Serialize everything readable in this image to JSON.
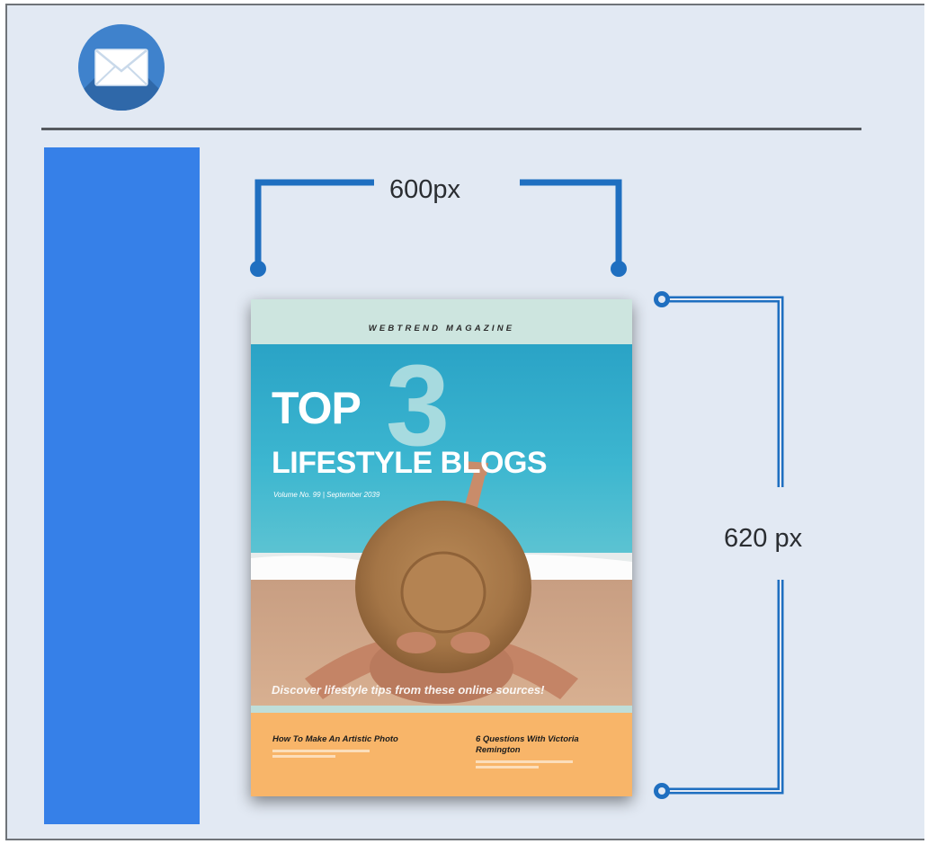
{
  "icons": {
    "mail": "envelope-icon"
  },
  "colors": {
    "frame_background": "#e2e9f3",
    "sidebar_bar": "#3680e8",
    "dimension_lines": "#1f6fc0",
    "badge": "#3f82cc"
  },
  "dimensions": {
    "width_label": "600px",
    "height_label": "620 px"
  },
  "cover": {
    "masthead": "WEBTREND MAGAZINE",
    "big_number": "3",
    "headline_top": "TOP",
    "headline_main": "LIFESTYLE BLOGS",
    "issue_line": "Volume No. 99 | September 2039",
    "tagline": "Discover lifestyle tips from these online sources!",
    "articles": [
      {
        "headline": "How To Make An Artistic Photo"
      },
      {
        "headline": "6 Questions With Victoria Remington"
      }
    ]
  }
}
